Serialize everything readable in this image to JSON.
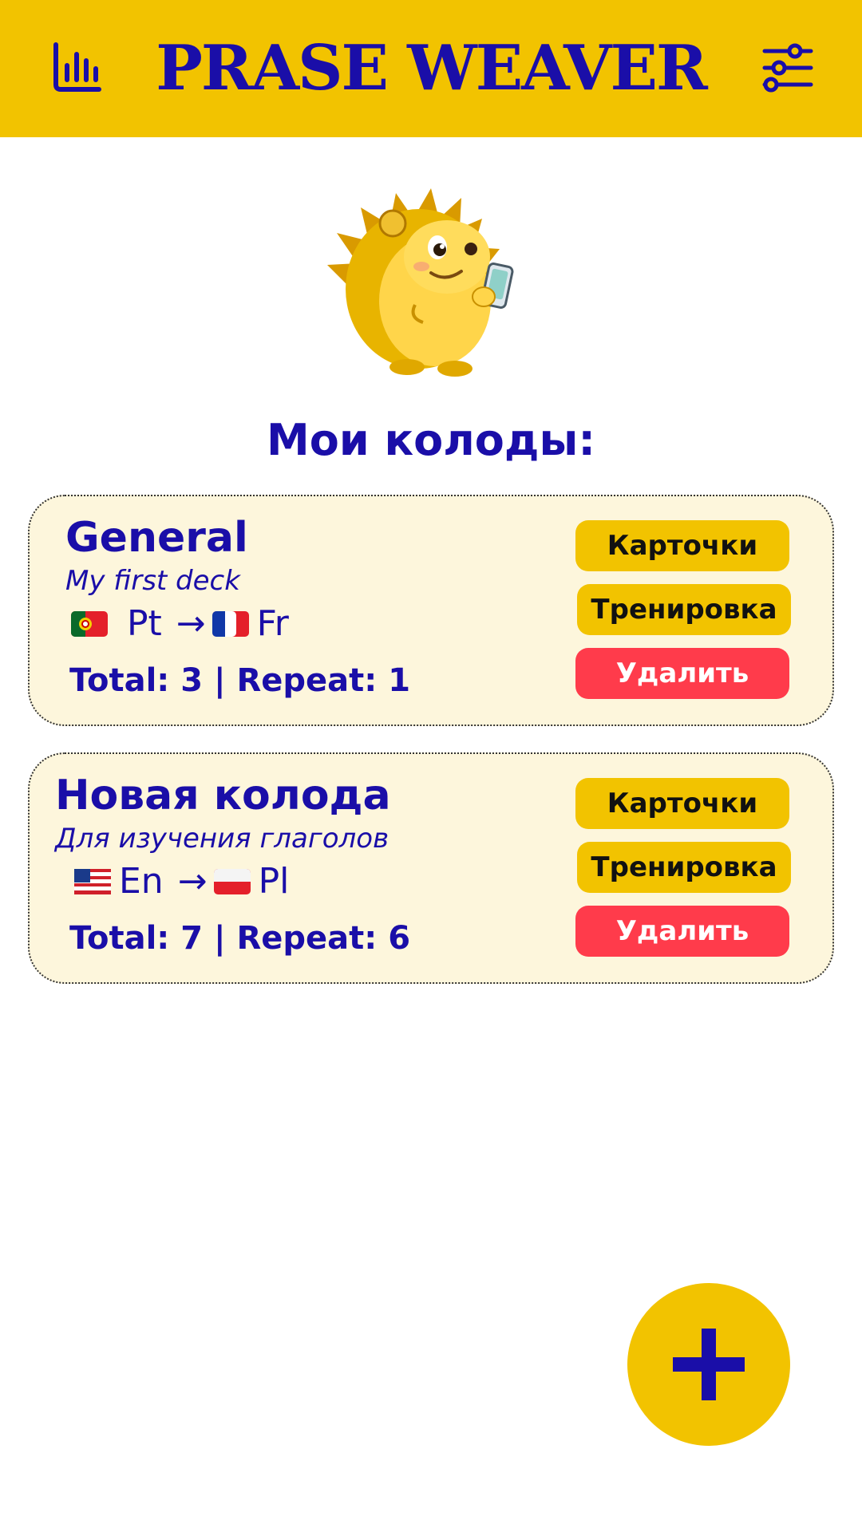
{
  "header": {
    "title": "PRASE WEAVER",
    "stats_icon": "bar-chart-icon",
    "settings_icon": "sliders-icon"
  },
  "mascot": {
    "icon": "hedgehog-mascot"
  },
  "section_title": "Мои колоды:",
  "decks": [
    {
      "name": "General",
      "description": "My first deck",
      "from_lang": "Pt",
      "to_lang": "Fr",
      "arrow": "→",
      "stats": "Total: 3 | Repeat: 1",
      "buttons": {
        "cards": "Карточки",
        "training": "Тренировка",
        "delete": "Удалить"
      }
    },
    {
      "name": "Новая колода",
      "description": "Для изучения глаголов",
      "from_lang": "En",
      "to_lang": "Pl",
      "arrow": "→",
      "stats": "Total: 7 | Repeat: 6",
      "buttons": {
        "cards": "Карточки",
        "training": "Тренировка",
        "delete": "Удалить"
      }
    }
  ],
  "fab": {
    "icon": "plus-icon"
  },
  "colors": {
    "accent": "#f2c300",
    "text": "#1a0ea8",
    "card_bg": "#fdf6dc",
    "danger": "#ff3b4b"
  }
}
